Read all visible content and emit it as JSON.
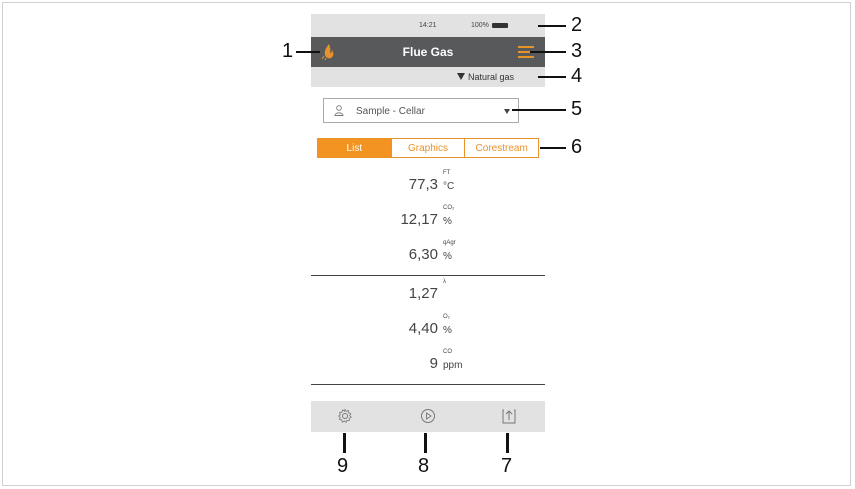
{
  "status_bar": {
    "time": "14:21",
    "battery": "100%"
  },
  "header": {
    "title": "Flue Gas"
  },
  "fuel": {
    "label": "Natural gas"
  },
  "location": {
    "label": "Sample - Cellar"
  },
  "tabs": [
    {
      "label": "List",
      "active": true
    },
    {
      "label": "Graphics",
      "active": false
    },
    {
      "label": "Corestream",
      "active": false
    }
  ],
  "readings": [
    {
      "value": "77,3",
      "param": "FT",
      "unit": "°C"
    },
    {
      "value": "12,17",
      "param": "CO₂",
      "unit": "%"
    },
    {
      "value": "6,30",
      "param": "qAgr",
      "unit": "%"
    },
    {
      "value": "1,27",
      "param": "λ",
      "unit": ""
    },
    {
      "value": "4,40",
      "param": "O₂",
      "unit": "%"
    },
    {
      "value": "9",
      "param": "CO",
      "unit": "ppm"
    }
  ],
  "bottom_bar": [
    "gear-icon",
    "play-icon",
    "export-icon"
  ],
  "callouts": [
    "1",
    "2",
    "3",
    "4",
    "5",
    "6",
    "7",
    "8",
    "9"
  ],
  "colors": {
    "accent": "#f39321",
    "header": "#57595b",
    "bar": "#e2e2e2"
  }
}
